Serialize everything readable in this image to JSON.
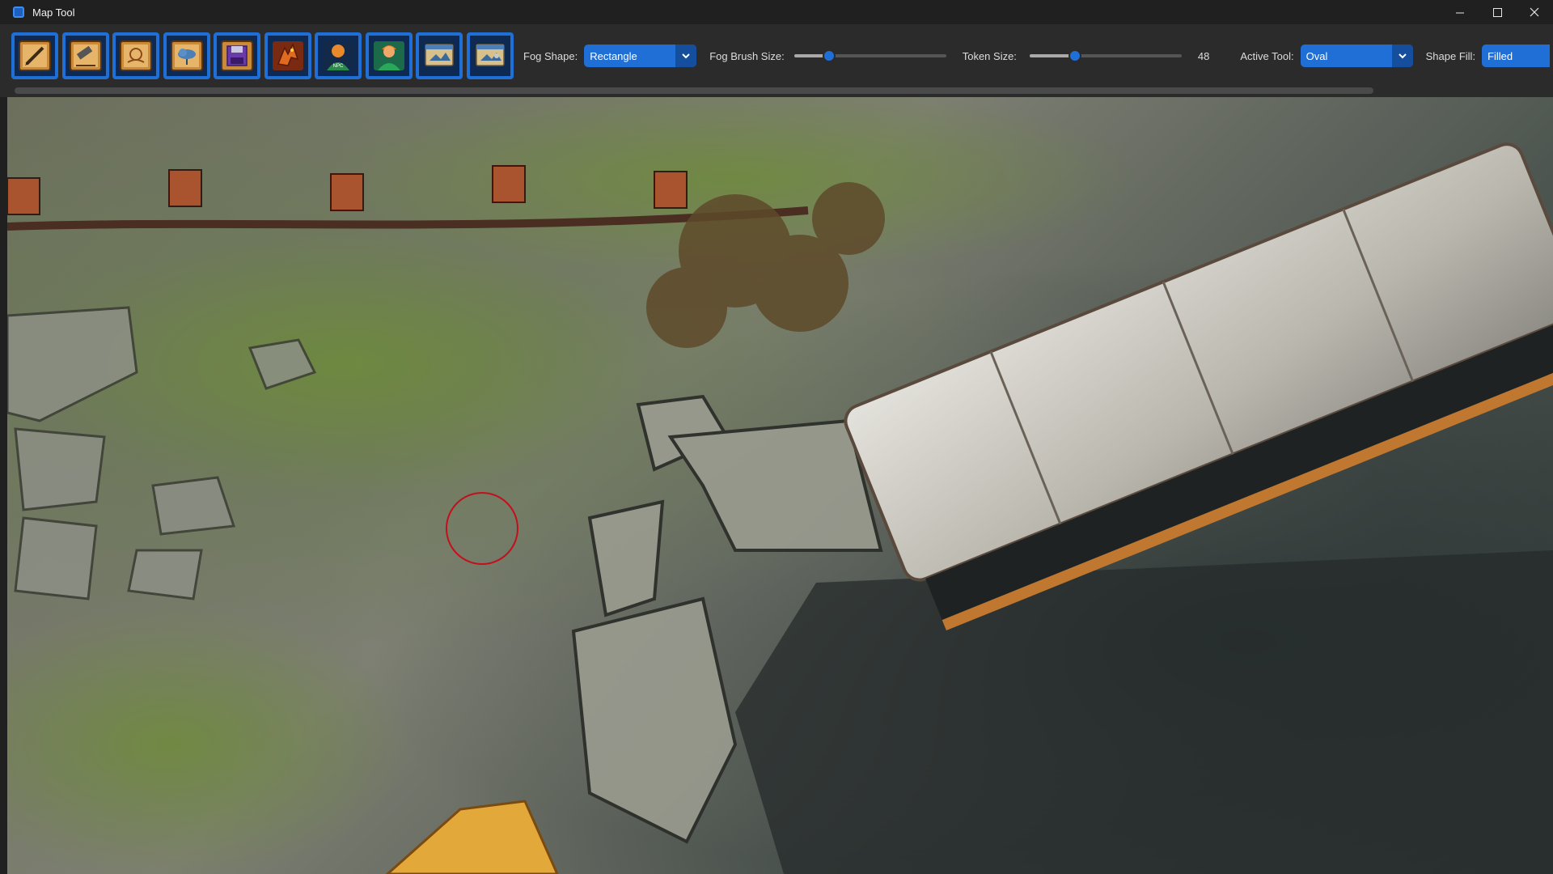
{
  "window": {
    "title": "Map Tool",
    "controls": [
      "minimize",
      "maximize",
      "close"
    ]
  },
  "toolbar": {
    "tool_buttons": [
      {
        "name": "draw-tool-icon"
      },
      {
        "name": "erase-tool-icon"
      },
      {
        "name": "map-load-icon"
      },
      {
        "name": "map-cloud-icon"
      },
      {
        "name": "save-icon"
      },
      {
        "name": "dragon-token-icon"
      },
      {
        "name": "npc-token-icon",
        "text": "NPC"
      },
      {
        "name": "player-token-icon"
      },
      {
        "name": "map-view-icon-1"
      },
      {
        "name": "map-view-icon-2"
      }
    ],
    "fog_shape": {
      "label": "Fog Shape:",
      "value": "Rectangle"
    },
    "fog_brush_size": {
      "label": "Fog Brush Size:",
      "level": 0.23
    },
    "token_size": {
      "label": "Token Size:",
      "value": "48",
      "level": 0.3
    },
    "active_tool": {
      "label": "Active Tool:",
      "value": "Oval"
    },
    "shape_fill": {
      "label": "Shape Fill:",
      "value": "Filled"
    }
  },
  "colors": {
    "accent": "#1f6fd6",
    "toolbar_bg": "#2b2b2b",
    "titlebar_bg": "#202020",
    "cursor_ring": "#c2101c"
  }
}
